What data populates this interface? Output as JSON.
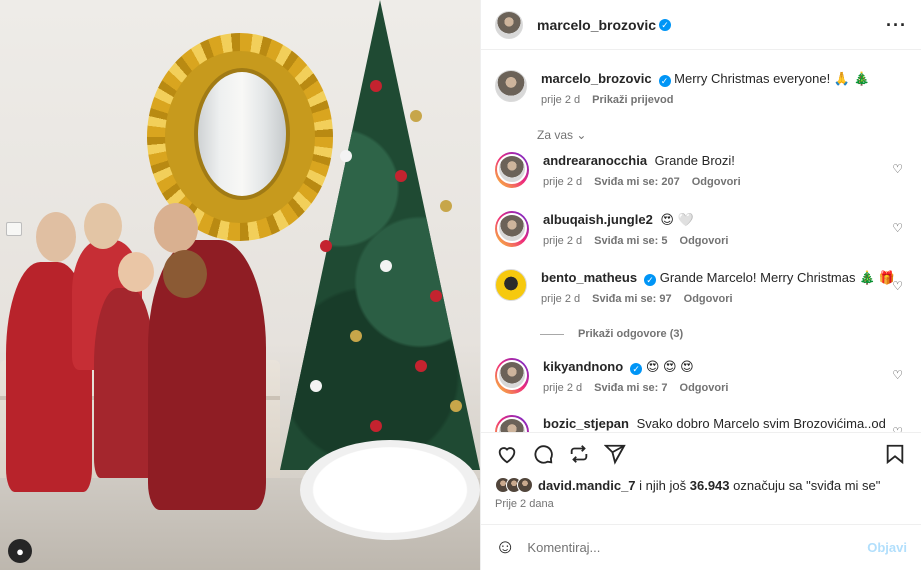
{
  "post": {
    "author": "marcelo_brozovic",
    "more_icon": "more-horizontal-icon",
    "caption": {
      "username": "marcelo_brozovic",
      "text": "Merry Christmas everyone! 🙏 🎄",
      "time": "prije 2 d",
      "translate": "Prikaži prijevod"
    }
  },
  "comments_section": {
    "for_you_label": "Za vas",
    "view_replies": "Prikaži odgovore (3)",
    "items": [
      {
        "username": "andrearanocchia",
        "text": "Grande Brozi!",
        "time": "prije 2 d",
        "likes": "Sviđa mi se: 207",
        "reply": "Odgovori",
        "verified": false
      },
      {
        "username": "albuqaish.jungle2",
        "text": "😍 🤍",
        "time": "prije 2 d",
        "likes": "Sviđa mi se: 5",
        "reply": "Odgovori",
        "verified": false
      },
      {
        "username": "bento_matheus",
        "text": "Grande Marcelo! Merry Christmas 🎄 🎁",
        "time": "prije 2 d",
        "likes": "Sviđa mi se: 97",
        "reply": "Odgovori",
        "verified": true
      },
      {
        "username": "kikyandnono",
        "text": "😍 😍 😍",
        "time": "prije 2 d",
        "likes": "Sviđa mi se: 7",
        "reply": "Odgovori",
        "verified": true
      },
      {
        "username": "bozic_stjepan",
        "text": "Svako dobro Marcelo svim Brozovićima..od",
        "time": "",
        "likes": "",
        "reply": "",
        "verified": false
      }
    ]
  },
  "actions": {
    "like_icon": "heart-icon",
    "comment_icon": "comment-icon",
    "share_icon": "repost-icon",
    "send_icon": "send-icon",
    "save_icon": "bookmark-icon"
  },
  "likes_summary": {
    "user": "david.mandic_7",
    "middle": " i njih još ",
    "count": "36.943",
    "suffix": " označuju sa \"sviđa mi se\""
  },
  "post_date": "Prije 2 dana",
  "composer": {
    "placeholder": "Komentiraj...",
    "submit": "Objavi"
  },
  "colors": {
    "accent": "#0095f6",
    "submit_disabled": "#b2dffc",
    "secondary_text": "#737373"
  }
}
